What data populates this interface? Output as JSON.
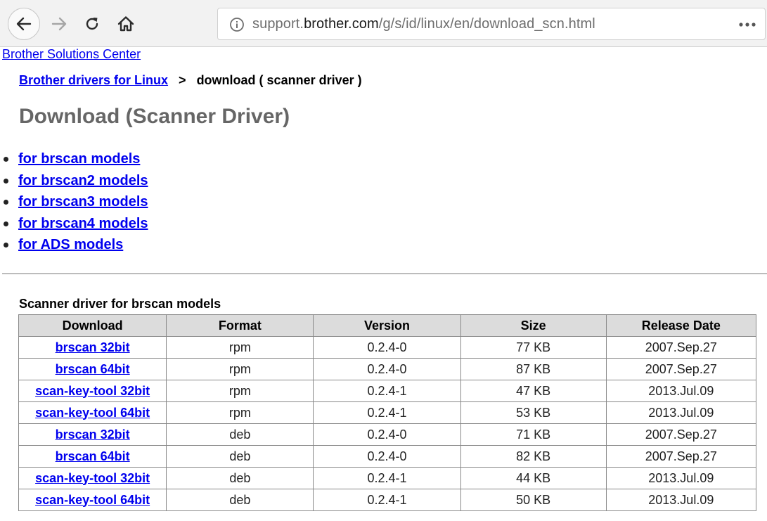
{
  "browser": {
    "url_prefix": "support.",
    "url_host": "brother.com",
    "url_path": "/g/s/id/linux/en/download_scn.html"
  },
  "page": {
    "top_link": "Brother Solutions Center",
    "breadcrumb": {
      "parent": "Brother drivers for Linux",
      "separator": ">",
      "current": "download ( scanner driver )"
    },
    "title": "Download (Scanner Driver)",
    "model_links": [
      "for brscan models",
      "for brscan2 models",
      "for brscan3 models",
      "for brscan4 models",
      "for ADS models"
    ],
    "section_caption": "Scanner driver for brscan models",
    "table": {
      "headers": [
        "Download",
        "Format",
        "Version",
        "Size",
        "Release Date"
      ],
      "rows": [
        {
          "download": "brscan 32bit",
          "format": "rpm",
          "version": "0.2.4-0",
          "size": "77 KB",
          "date": "2007.Sep.27"
        },
        {
          "download": "brscan 64bit",
          "format": "rpm",
          "version": "0.2.4-0",
          "size": "87 KB",
          "date": "2007.Sep.27"
        },
        {
          "download": "scan-key-tool 32bit",
          "format": "rpm",
          "version": "0.2.4-1",
          "size": "47 KB",
          "date": "2013.Jul.09"
        },
        {
          "download": "scan-key-tool 64bit",
          "format": "rpm",
          "version": "0.2.4-1",
          "size": "53 KB",
          "date": "2013.Jul.09"
        },
        {
          "download": "brscan 32bit",
          "format": "deb",
          "version": "0.2.4-0",
          "size": "71 KB",
          "date": "2007.Sep.27"
        },
        {
          "download": "brscan 64bit",
          "format": "deb",
          "version": "0.2.4-0",
          "size": "82 KB",
          "date": "2007.Sep.27"
        },
        {
          "download": "scan-key-tool 32bit",
          "format": "deb",
          "version": "0.2.4-1",
          "size": "44 KB",
          "date": "2013.Jul.09"
        },
        {
          "download": "scan-key-tool 64bit",
          "format": "deb",
          "version": "0.2.4-1",
          "size": "50 KB",
          "date": "2013.Jul.09"
        }
      ]
    }
  },
  "colors": {
    "link": "#0000ee",
    "title": "#666666",
    "table_header_bg": "#dcdcdc",
    "toolbar_bg": "#f2f2f2"
  },
  "icons": [
    "back-arrow-icon",
    "forward-arrow-icon",
    "reload-icon",
    "home-icon",
    "info-icon",
    "more-menu-icon"
  ]
}
